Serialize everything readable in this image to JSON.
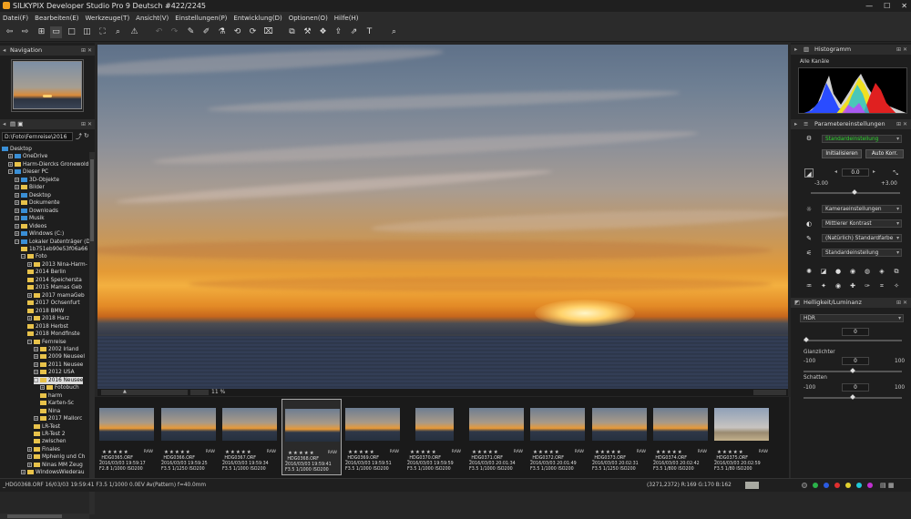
{
  "window": {
    "title": "SILKYPIX Developer Studio Pro 9 Deutsch   #422/2245",
    "minimize": "—",
    "maximize": "☐",
    "close": "✕"
  },
  "menu": [
    "Datei(F)",
    "Bearbeiten(E)",
    "Werkzeuge(T)",
    "Ansicht(V)",
    "Einstellungen(P)",
    "Entwicklung(D)",
    "Optionen(O)",
    "Hilfe(H)"
  ],
  "left": {
    "nav_title": "Navigation",
    "path": "D:\\Foto\\Fernreise\\2016",
    "tree": [
      {
        "label": "Desktop",
        "indent": 0,
        "icon": "pc",
        "exp": ""
      },
      {
        "label": "OneDrive",
        "indent": 1,
        "icon": "pc",
        "exp": "+"
      },
      {
        "label": "Harm-Diercks Gronewold",
        "indent": 1,
        "icon": "fold",
        "exp": "+"
      },
      {
        "label": "Dieser PC",
        "indent": 1,
        "icon": "pc",
        "exp": "−"
      },
      {
        "label": "3D-Objekte",
        "indent": 2,
        "icon": "pc",
        "exp": "+"
      },
      {
        "label": "Bilder",
        "indent": 2,
        "icon": "fold",
        "exp": "+"
      },
      {
        "label": "Desktop",
        "indent": 2,
        "icon": "pc",
        "exp": "+"
      },
      {
        "label": "Dokumente",
        "indent": 2,
        "icon": "fold",
        "exp": "+"
      },
      {
        "label": "Downloads",
        "indent": 2,
        "icon": "pc",
        "exp": "+"
      },
      {
        "label": "Musik",
        "indent": 2,
        "icon": "pc",
        "exp": "+"
      },
      {
        "label": "Videos",
        "indent": 2,
        "icon": "fold",
        "exp": "+"
      },
      {
        "label": "Windows (C:)",
        "indent": 2,
        "icon": "pc",
        "exp": "+"
      },
      {
        "label": "Lokaler Datenträger (D:)",
        "indent": 2,
        "icon": "pc",
        "exp": "−"
      },
      {
        "label": "1b751eb90e53f06a66",
        "indent": 3,
        "icon": "fold",
        "exp": ""
      },
      {
        "label": "Foto",
        "indent": 3,
        "icon": "fold",
        "exp": "−"
      },
      {
        "label": "2013 Nina-Harm-",
        "indent": 4,
        "icon": "fold",
        "exp": "+"
      },
      {
        "label": "2014 Berlin",
        "indent": 4,
        "icon": "fold",
        "exp": ""
      },
      {
        "label": "2014 Speichersta",
        "indent": 4,
        "icon": "fold",
        "exp": ""
      },
      {
        "label": "2015 Mamas Geb",
        "indent": 4,
        "icon": "fold",
        "exp": ""
      },
      {
        "label": "2017 mamaGeb",
        "indent": 4,
        "icon": "fold",
        "exp": "+"
      },
      {
        "label": "2017 Ochsenfurt",
        "indent": 4,
        "icon": "fold",
        "exp": ""
      },
      {
        "label": "2018 BMW",
        "indent": 4,
        "icon": "fold",
        "exp": ""
      },
      {
        "label": "2018 Harz",
        "indent": 4,
        "icon": "fold",
        "exp": "+"
      },
      {
        "label": "2018 Herbst",
        "indent": 4,
        "icon": "fold",
        "exp": ""
      },
      {
        "label": "2018 Mondfinste",
        "indent": 4,
        "icon": "fold",
        "exp": ""
      },
      {
        "label": "Fernreise",
        "indent": 4,
        "icon": "fold",
        "exp": "−"
      },
      {
        "label": "2002 Irland",
        "indent": 5,
        "icon": "fold",
        "exp": "+"
      },
      {
        "label": "2009 Neuseel",
        "indent": 5,
        "icon": "fold",
        "exp": "+"
      },
      {
        "label": "2011 Neusee",
        "indent": 5,
        "icon": "fold",
        "exp": "+"
      },
      {
        "label": "2012 USA",
        "indent": 5,
        "icon": "fold",
        "exp": "+"
      },
      {
        "label": "2016 Neusee",
        "indent": 5,
        "icon": "fold",
        "exp": "−",
        "selected": true
      },
      {
        "label": "Fotobuch",
        "indent": 6,
        "icon": "fold",
        "exp": "+"
      },
      {
        "label": "harm",
        "indent": 6,
        "icon": "fold",
        "exp": ""
      },
      {
        "label": "Karten-Sc",
        "indent": 6,
        "icon": "fold",
        "exp": ""
      },
      {
        "label": "Nina",
        "indent": 6,
        "icon": "fold",
        "exp": ""
      },
      {
        "label": "2017 Mallorc",
        "indent": 5,
        "icon": "fold",
        "exp": "+"
      },
      {
        "label": "LR-Test",
        "indent": 5,
        "icon": "fold",
        "exp": ""
      },
      {
        "label": "LR-Test 2",
        "indent": 5,
        "icon": "fold",
        "exp": ""
      },
      {
        "label": "zwischen",
        "indent": 5,
        "icon": "fold",
        "exp": ""
      },
      {
        "label": "Finales",
        "indent": 4,
        "icon": "fold",
        "exp": "+"
      },
      {
        "label": "Mphenig und Ch",
        "indent": 4,
        "icon": "fold",
        "exp": "+"
      },
      {
        "label": "Ninas MM Zeug",
        "indent": 4,
        "icon": "fold",
        "exp": "+"
      },
      {
        "label": "WindowsWiederau",
        "indent": 3,
        "icon": "fold",
        "exp": "+"
      }
    ]
  },
  "viewer": {
    "zoom": "11 %"
  },
  "filmstrip": [
    {
      "name": "_HDG0365.ORF",
      "date": "2016/03/03 19:59:17",
      "exp": "F2.8 1/1000 ISO200"
    },
    {
      "name": "_HDG0366.ORF",
      "date": "2016/03/03 19:59:25",
      "exp": "F3.5 1/1250 ISO200"
    },
    {
      "name": "_HDG0367.ORF",
      "date": "2016/03/03 19:59:34",
      "exp": "F3.5 1/1000 ISO200"
    },
    {
      "name": "_HDG0368.ORF",
      "date": "2016/03/03 19:59:41",
      "exp": "F3.5 1/1000 ISO200",
      "selected": true
    },
    {
      "name": "_HDG0369.ORF",
      "date": "2016/03/03 19:59:51",
      "exp": "F3.5 1/1000 ISO200"
    },
    {
      "name": "_HDG0370.ORF",
      "date": "2016/03/03 19:59:59",
      "exp": "F3.5 1/1000 ISO200"
    },
    {
      "name": "_HDG0371.ORF",
      "date": "2016/03/03 20:01:34",
      "exp": "F3.5 1/1000 ISO200"
    },
    {
      "name": "_HDG0372.ORF",
      "date": "2016/03/03 20:01:49",
      "exp": "F3.5 1/1000 ISO200"
    },
    {
      "name": "_HDG0373.ORF",
      "date": "2016/03/03 20:02:31",
      "exp": "F3.5 1/1250 ISO200"
    },
    {
      "name": "_HDG0374.ORF",
      "date": "2016/03/03 20:02:42",
      "exp": "F3.5 1/800 ISO200"
    },
    {
      "name": "_HDG0375.ORF",
      "date": "2016/03/03 20:02:59",
      "exp": "F3.5 1/80 ISO200"
    }
  ],
  "filmstrip_stars": "★★★★★",
  "filmstrip_raw": "RAW",
  "right": {
    "histogram_title": "Histogramm",
    "channel": "Alle Kanäle",
    "params_title": "Parametereinstellungen",
    "preset": "Standardeinstellung",
    "init_button": "Initialisieren",
    "auto_button": "Auto Korr.",
    "exposure_value": "0.0",
    "exposure_min": "-3.00",
    "exposure_max": "+3.00",
    "combos": [
      "Kameraeinstellungen",
      "Mittlerer Kontrast",
      "(Natürlich) Standardfarbe",
      "Standardeinstellung"
    ],
    "hl_title": "Helligkeit/Luminanz",
    "hdr_label": "HDR",
    "hdr_value": "0",
    "glanz_label": "Glanzlichter",
    "glanz_value": "0",
    "glanz_min": "-100",
    "glanz_max": "100",
    "schatten_label": "Schatten",
    "schatten_value": "0",
    "schatten_min": "-100",
    "schatten_max": "100"
  },
  "status": {
    "left": "_HDG0368.ORF 16/03/03 19:59:41 F3.5 1/1000 0.0EV Av(Pattern) f=40.0mm",
    "coords": "(3271,2372) R:169 G:170 B:162"
  }
}
